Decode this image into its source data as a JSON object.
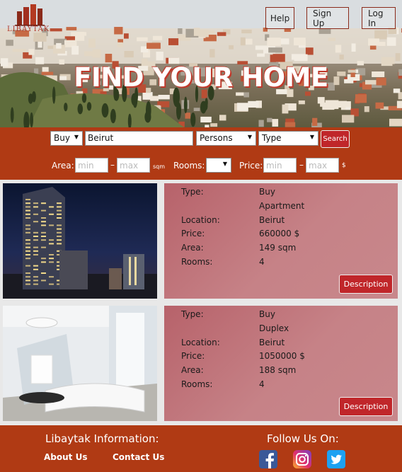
{
  "header": {
    "logo_text": "LIBAYTAK",
    "nav": {
      "help": "Help",
      "signup": "Sign Up",
      "login": "Log In"
    },
    "hero_title": "FIND YOUR HOME"
  },
  "search": {
    "mode_selected": "Buy",
    "location_value": "Beirut",
    "persons_selected": "Persons",
    "type_selected": "Type",
    "search_label": "Search",
    "area_label": "Area:",
    "area_min_placeholder": "min",
    "area_max_placeholder": "max",
    "area_unit": "sqm",
    "rooms_label": "Rooms:",
    "price_label": "Price:",
    "price_min_placeholder": "min",
    "price_max_placeholder": "max",
    "price_unit": "$",
    "dash": "–"
  },
  "listings": [
    {
      "type_key": "Type:",
      "type_val": "Buy",
      "sub_val": "Apartment",
      "location_key": "Location:",
      "location_val": "Beirut",
      "price_key": "Price:",
      "price_val": "660000 $",
      "area_key": "Area:",
      "area_val": "149 sqm",
      "rooms_key": "Rooms:",
      "rooms_val": "4",
      "desc_label": "Description"
    },
    {
      "type_key": "Type:",
      "type_val": "Buy",
      "sub_val": "Duplex",
      "location_key": "Location:",
      "location_val": "Beirut",
      "price_key": "Price:",
      "price_val": "1050000 $",
      "area_key": "Area:",
      "area_val": "188 sqm",
      "rooms_key": "Rooms:",
      "rooms_val": "4",
      "desc_label": "Description"
    }
  ],
  "footer": {
    "info_heading": "Libaytak Information:",
    "about": "About Us",
    "contact": "Contact Us",
    "follow_heading": "Follow Us On:",
    "social_icons": [
      "facebook-icon",
      "instagram-icon",
      "twitter-icon"
    ]
  },
  "colors": {
    "brand_red": "#b03a14",
    "button_red": "#c0262a",
    "card_pink": "#c68287"
  }
}
